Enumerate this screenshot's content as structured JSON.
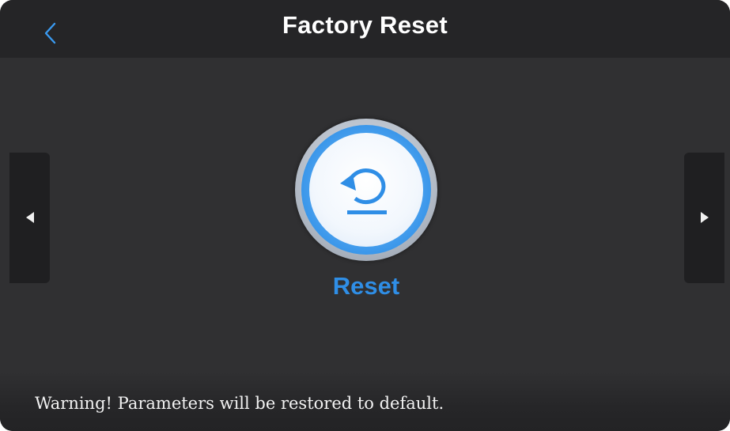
{
  "header": {
    "title": "Factory Reset",
    "back_icon": "chevron-left-icon"
  },
  "nav": {
    "prev_icon": "triangle-left-icon",
    "next_icon": "triangle-right-icon"
  },
  "main": {
    "reset_icon": "undo-arrow-icon",
    "reset_label": "Reset"
  },
  "footer": {
    "warning": "Warning! Parameters will be restored to default."
  },
  "colors": {
    "background": "#303032",
    "header": "#252527",
    "accent": "#2f8ee6",
    "side_button": "#1f1f21"
  }
}
